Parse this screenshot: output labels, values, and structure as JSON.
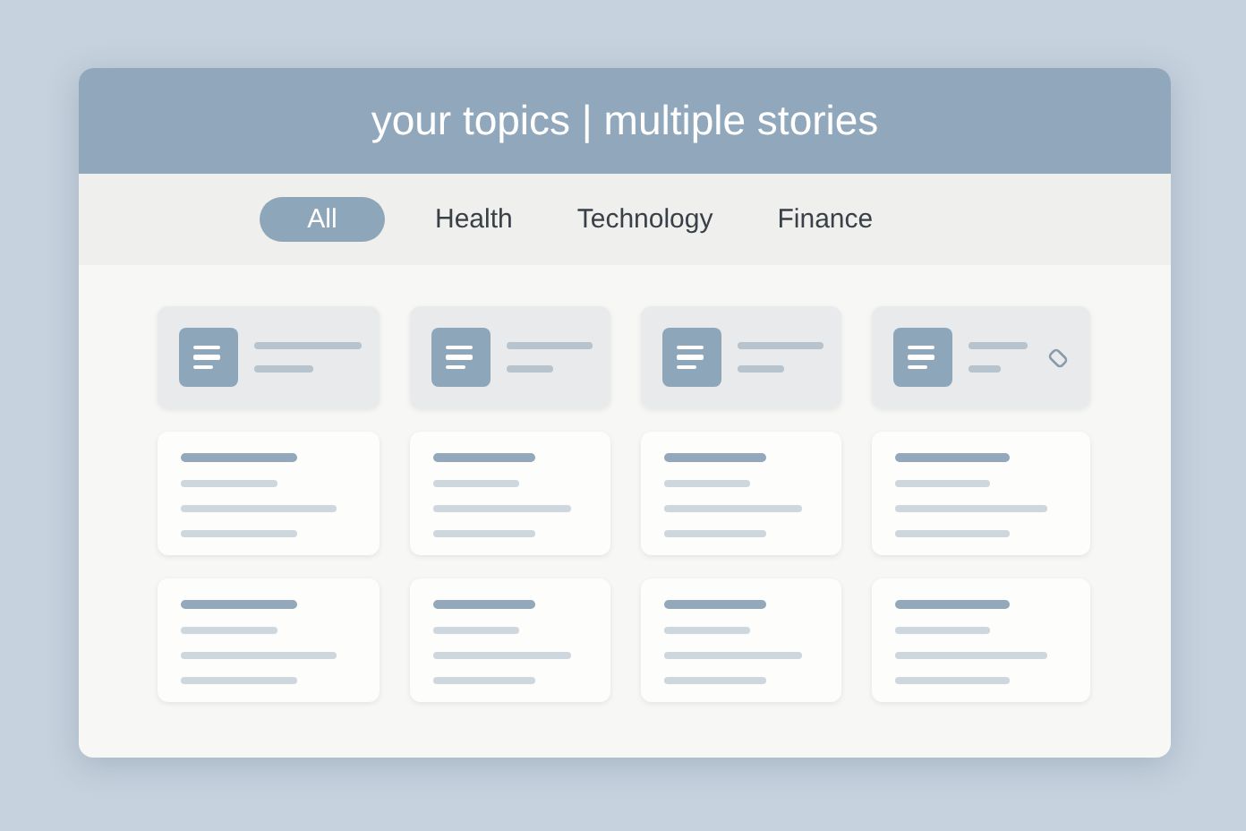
{
  "window": {
    "title": "your topics | multiple stories"
  },
  "tabs": [
    {
      "label": "All",
      "selected": true
    },
    {
      "label": "Health",
      "selected": false
    },
    {
      "label": "Technology",
      "selected": false
    },
    {
      "label": "Finance",
      "selected": false
    }
  ],
  "topic_cards": [
    {
      "tagged": false
    },
    {
      "tagged": false
    },
    {
      "tagged": false
    },
    {
      "tagged": true
    }
  ]
}
